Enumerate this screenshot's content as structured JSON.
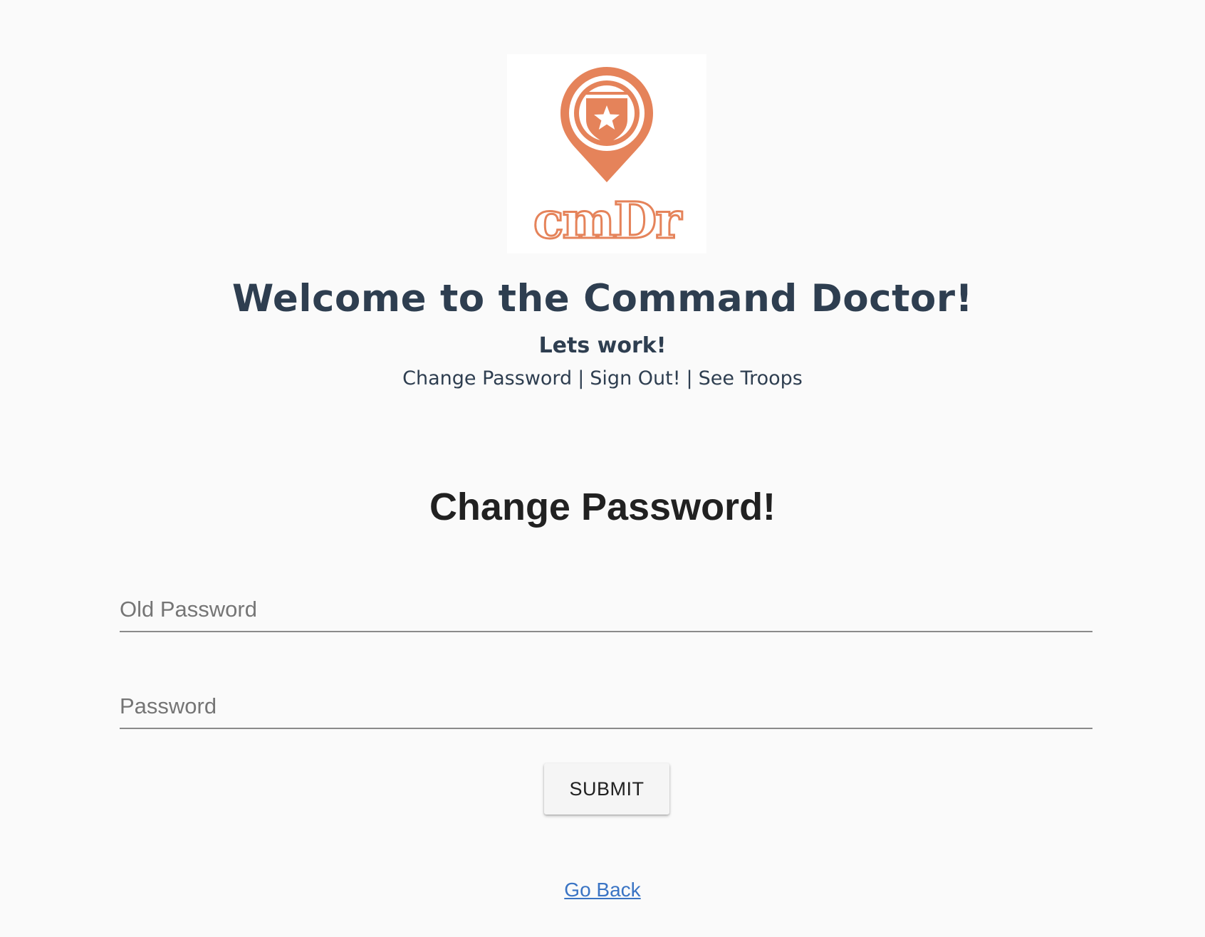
{
  "brand": {
    "logo_text": "cmDr",
    "logo_color": "#e5835a",
    "logo_icon": "shield-star-map-pin-icon"
  },
  "header": {
    "title": "Welcome to the Command Doctor!",
    "subtitle": "Lets work!",
    "nav": {
      "change_password": "Change Password",
      "sign_out": "Sign Out!",
      "see_troops": "See Troops",
      "separator": "|"
    }
  },
  "form": {
    "title": "Change Password!",
    "old_password": {
      "placeholder": "Old Password",
      "value": ""
    },
    "new_password": {
      "placeholder": "Password",
      "value": ""
    },
    "submit_label": "SUBMIT"
  },
  "footer": {
    "go_back": "Go Back"
  },
  "colors": {
    "heading": "#2e3e50",
    "link": "#3a74c4",
    "background": "#fafafa"
  }
}
